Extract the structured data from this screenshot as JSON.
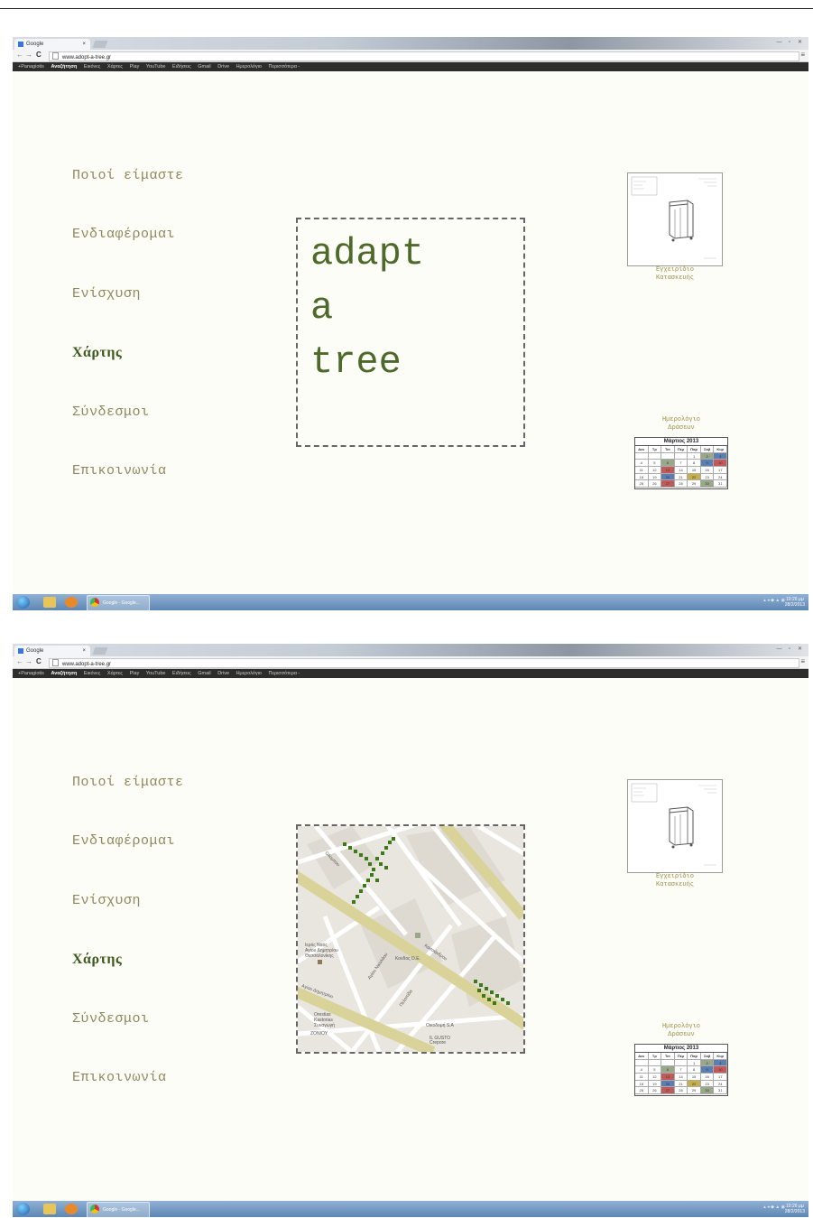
{
  "browser": {
    "tab_title": "Google",
    "tab_close": "×",
    "url": "www.adopt-a-tree.gr",
    "google_bar": [
      "+Panagiotis",
      "Αναζήτηση",
      "Εικόνες",
      "Χάρτες",
      "Play",
      "YouTube",
      "Ειδήσεις",
      "Gmail",
      "Drive",
      "Ημερολόγιο",
      "Περισσότερα -"
    ]
  },
  "site": {
    "menu": [
      "Ποιοί είμαστε",
      "Ενδιαφέρομαι",
      "Ενίσχυση",
      "Χάρτης",
      "Σύνδεσμοι",
      "Επικοινωνία"
    ],
    "active_item": "Χάρτης",
    "logo_lines": [
      "adapt",
      "a",
      "tree"
    ],
    "manual_caption_1": "Εγχειρίδιο",
    "manual_caption_2": "Κατασκευής",
    "calendar_caption_1": "Ημερολόγιο",
    "calendar_caption_2": "Δράσεων",
    "calendar": {
      "title": "Μάρτιος 2013",
      "weekdays": [
        "Δευ",
        "Τρ",
        "Τετ",
        "Πεμ",
        "Παρ",
        "Σαβ",
        "Κυρ"
      ],
      "rows": [
        [
          "",
          "",
          "",
          "",
          "1",
          "2",
          "3"
        ],
        [
          "4",
          "5",
          "6",
          "7",
          "8",
          "9",
          "10"
        ],
        [
          "11",
          "12",
          "13",
          "14",
          "15",
          "16",
          "17"
        ],
        [
          "18",
          "19",
          "20",
          "21",
          "22",
          "23",
          "24"
        ],
        [
          "25",
          "26",
          "27",
          "28",
          "29",
          "30",
          "31"
        ]
      ]
    }
  },
  "map_labels": [
    "Ιερός Ναός Αγίου Δημητρίου Θεσσαλονίκης",
    "Κασσάνδρου",
    "Αγίου Δημητρίου",
    "Κονδος Ο.Ε.",
    "Orestias Kastorias Συναγωγή",
    "ZONIOY",
    "Οικοδομή S.A",
    "IL GUSTO Crepore",
    "Ολύμπου",
    "Αγίου Νικολάου",
    "Πελοπίδα"
  ],
  "taskbar": {
    "task": "Google - Google...",
    "time": "10:26 μμ",
    "date": "28/2/2013"
  },
  "colors": {
    "menu_text": "#8b8a5c",
    "menu_active": "#3d5a1c",
    "logo": "#4e6a2b",
    "tree_marker": "#3b7a16"
  }
}
